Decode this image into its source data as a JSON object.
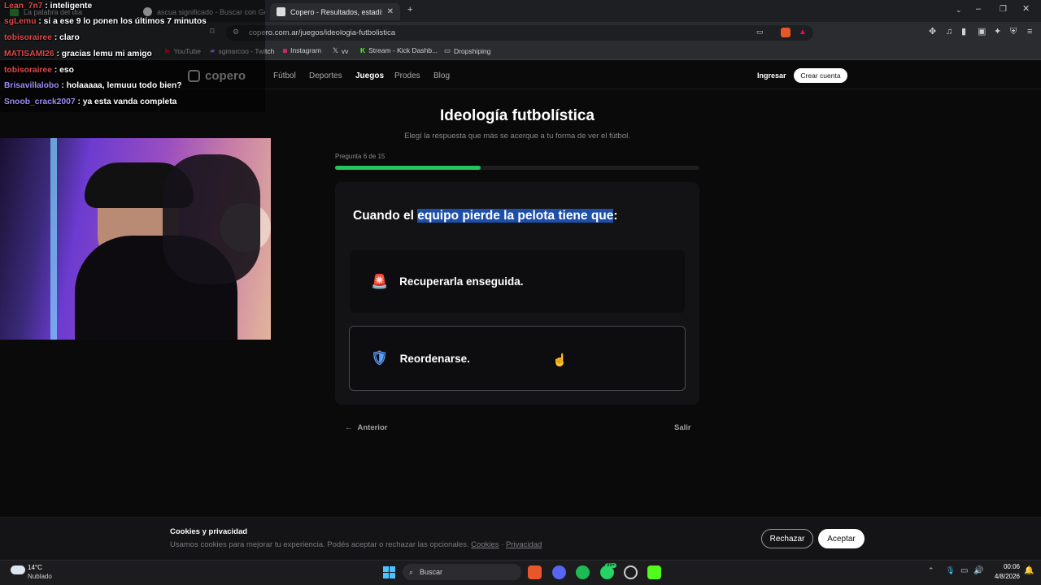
{
  "browser": {
    "tabs": [
      {
        "label": "La palabra del día"
      },
      {
        "label": "ascua significado - Buscar con Google"
      },
      {
        "label": "Copero - Resultados, estadísticas"
      }
    ],
    "url": "copero.com.ar/juegos/ideologia-futbolistica",
    "bookmarks": [
      "YouTube",
      "sgmarcoo - Twitch",
      "Instagram",
      "vv",
      "Stream - Kick Dashb...",
      "Dropshiping"
    ]
  },
  "site": {
    "logo": "copero",
    "nav": [
      "Fútbol",
      "Deportes",
      "Juegos",
      "Prodes",
      "Blog"
    ],
    "login": "Ingresar",
    "signup": "Crear cuenta",
    "title": "Ideología futbolística",
    "subtitle": "Elegí la respuesta que más se acerque a tu forma de ver el fútbol.",
    "progress_label": "Pregunta 6 de 15",
    "progress": 0.4,
    "question_prefix": "Cuando el ",
    "question_highlight": "equipo pierde la pelota tiene que",
    "question_suffix": ":",
    "options": [
      {
        "icon": "siren-icon",
        "label": "Recuperarla enseguida."
      },
      {
        "icon": "shield-icon",
        "label": "Reordenarse."
      }
    ],
    "back": "Anterior",
    "exit": "Salir"
  },
  "chat": [
    {
      "user": "Lean_7n7",
      "color": "#e04848",
      "msg": ": inteligente"
    },
    {
      "user": "sgLemu",
      "color": "#e04848",
      "msg": ": si a ese 9 lo ponen los últimos 7 minutos"
    },
    {
      "user": "tobisorairee",
      "color": "#e04848",
      "msg": ": claro"
    },
    {
      "user": "MATISAMI26",
      "color": "#e04848",
      "msg": ": gracias lemu mi amigo"
    },
    {
      "user": "tobisorairee",
      "color": "#e04848",
      "msg": ": eso"
    },
    {
      "user": "Brisavillalobo",
      "color": "#9a8cf5",
      "msg": ": holaaaaa, lemuuu todo bien?"
    },
    {
      "user": "Snoob_crack2007",
      "color": "#9a8cf5",
      "msg": ": ya esta vanda completa"
    }
  ],
  "cookie": {
    "title": "Cookies y privacidad",
    "text": "Usamos cookies para mejorar tu experiencia. Podés aceptar o rechazar las opcionales.",
    "link_cookies": "Cookies",
    "separator": "·",
    "link_privacy": "Privacidad",
    "reject": "Rechazar",
    "accept": "Aceptar"
  },
  "taskbar": {
    "temp": "14°C",
    "weather": "Nublado",
    "search": "Buscar",
    "time": "00:06",
    "date": "4/8/2026",
    "badge": "99+"
  },
  "colors": {
    "accent": "#22c55e",
    "highlight": "#1d4fa8",
    "page_bg": "#0a0a0b"
  }
}
